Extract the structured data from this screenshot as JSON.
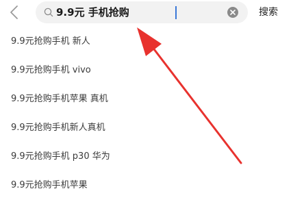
{
  "search": {
    "value": "9.9元 手机抢购",
    "button_label": "搜索"
  },
  "suggestions": [
    "9.9元抢购手机 新人",
    "9.9元抢购手机 vivo",
    "9.9元抢购手机苹果 真机",
    "9.9元抢购手机新人真机",
    "9.9元抢购手机 p30 华为",
    "9.9元抢购手机苹果"
  ],
  "colors": {
    "annotation_arrow": "#e8322e",
    "caret": "#3a78d8",
    "search_bg": "#f2f2f2"
  },
  "icons": {
    "back": "chevron-left-icon",
    "search": "search-icon",
    "clear": "clear-icon"
  }
}
